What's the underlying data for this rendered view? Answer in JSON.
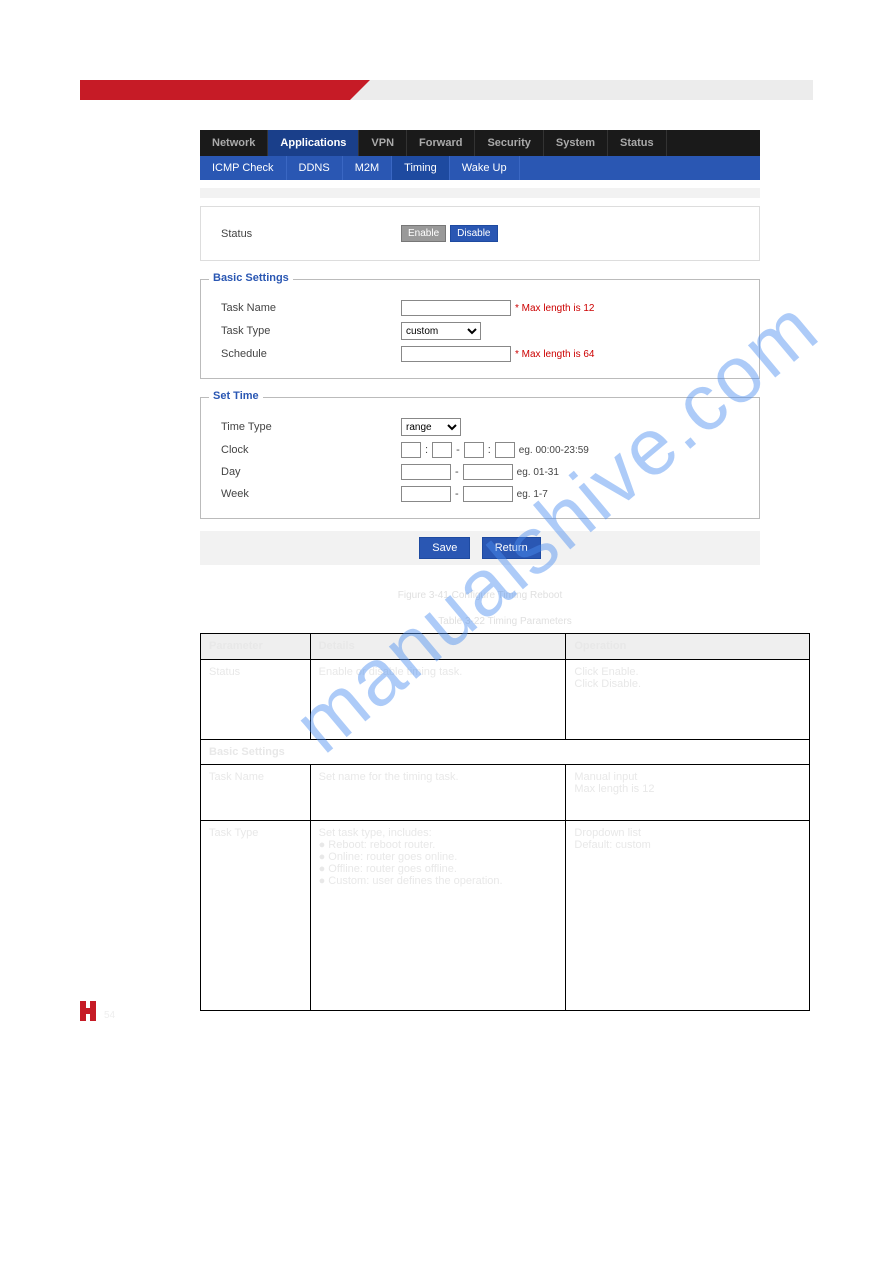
{
  "figure_label": "Figure 3-41   Configure Timing Reboot",
  "table_label": "Table 3-22   Timing Parameters",
  "main_tabs": [
    {
      "label": "Network",
      "active": false
    },
    {
      "label": "Applications",
      "active": true
    },
    {
      "label": "VPN",
      "active": false
    },
    {
      "label": "Forward",
      "active": false
    },
    {
      "label": "Security",
      "active": false
    },
    {
      "label": "System",
      "active": false
    },
    {
      "label": "Status",
      "active": false
    }
  ],
  "sub_tabs": [
    {
      "label": "ICMP Check",
      "active": false
    },
    {
      "label": "DDNS",
      "active": false
    },
    {
      "label": "M2M",
      "active": false
    },
    {
      "label": "Timing",
      "active": true
    },
    {
      "label": "Wake Up",
      "active": false
    }
  ],
  "status": {
    "label": "Status",
    "enable": "Enable",
    "disable": "Disable"
  },
  "basic": {
    "legend": "Basic Settings",
    "task_name_label": "Task Name",
    "task_name_hint": "* Max length is 12",
    "task_type_label": "Task Type",
    "task_type_value": "custom",
    "schedule_label": "Schedule",
    "schedule_hint": "* Max length is 64"
  },
  "settime": {
    "legend": "Set Time",
    "time_type_label": "Time Type",
    "time_type_value": "range",
    "clock_label": "Clock",
    "clock_hint": "eg. 00:00-23:59",
    "day_label": "Day",
    "day_hint": "eg. 01-31",
    "week_label": "Week",
    "week_hint": "eg. 1-7"
  },
  "buttons": {
    "save": "Save",
    "return": "Return"
  },
  "table": {
    "headers": [
      "Parameter",
      "Details",
      "Operation"
    ],
    "row_status": {
      "p": "Status",
      "d": "Enable or disable timing task.",
      "o": "Click Enable.\nClick Disable."
    },
    "section1": "Basic Settings",
    "row_taskname": {
      "p": "Task Name",
      "d": "Set name for the timing task.",
      "o": "Manual input\nMax length is 12"
    },
    "row_tasktype": {
      "p": "Task Type",
      "d": "Set task type, includes:\n● Reboot: reboot router.\n● Online: router goes online.\n● Offline: router goes offline.\n● Custom: user defines the operation.",
      "o": "Dropdown list\nDefault: custom"
    }
  },
  "watermark": "manualshive.com",
  "page_number": "54"
}
